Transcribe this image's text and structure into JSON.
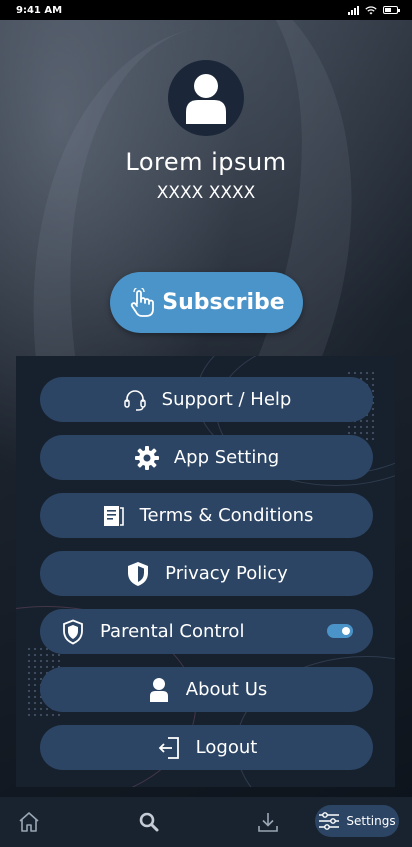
{
  "status_bar": {
    "time": "9:41 AM"
  },
  "profile": {
    "name": "Lorem ipsum",
    "subtitle": "XXXX XXXX",
    "icon": "user-icon"
  },
  "subscribe": {
    "label": "Subscribe",
    "icon": "hand-pointer-icon",
    "color": "#4b94c9"
  },
  "menu": {
    "items": [
      {
        "label": "Support / Help",
        "icon": "headset-icon"
      },
      {
        "label": "App Setting",
        "icon": "gear-icon"
      },
      {
        "label": "Terms & Conditions",
        "icon": "document-icon"
      },
      {
        "label": "Privacy Policy",
        "icon": "shield-icon"
      },
      {
        "label": "Parental Control",
        "icon": "shield-check-icon",
        "toggle_on": true
      },
      {
        "label": "About Us",
        "icon": "person-icon"
      },
      {
        "label": "Logout",
        "icon": "logout-icon"
      }
    ],
    "button_color": "#2c4564"
  },
  "bottom_nav": {
    "items": [
      {
        "icon": "home-icon"
      },
      {
        "icon": "search-icon"
      },
      {
        "icon": "download-icon"
      },
      {
        "icon": "sliders-icon",
        "label": "Settings",
        "active": true
      }
    ]
  },
  "colors": {
    "accent": "#4b94c9",
    "panel": "#17212e",
    "nav": "#18232f"
  }
}
